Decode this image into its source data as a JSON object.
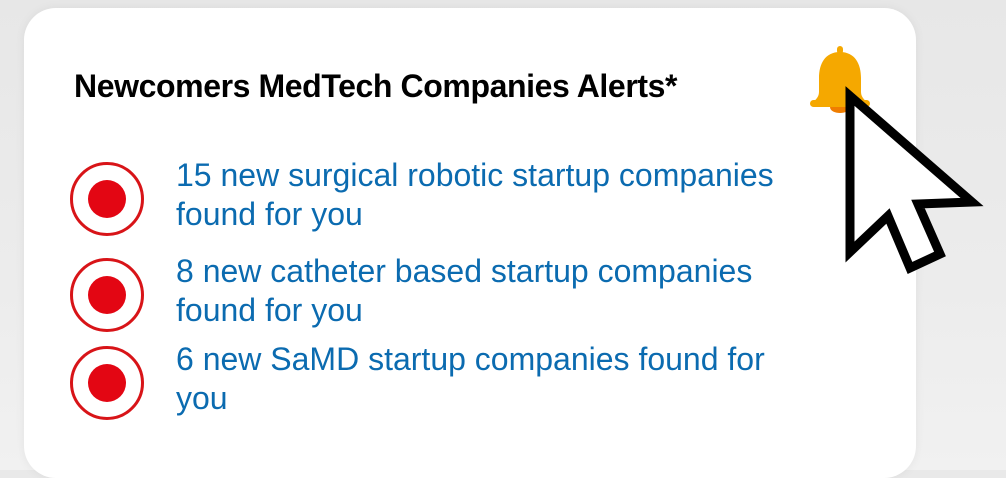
{
  "card": {
    "title": "Newcomers MedTech Companies Alerts*"
  },
  "alerts": [
    {
      "text": "15 new surgical robotic startup companies found for you"
    },
    {
      "text": "8 new catheter based startup companies found for you"
    },
    {
      "text": "6 new SaMD startup companies found for you"
    }
  ],
  "icons": {
    "bell": "bell-icon",
    "bullet": "record-icon",
    "cursor": "mouse-pointer-icon"
  },
  "colors": {
    "title": "#000000",
    "link": "#0b6bb0",
    "bullet": "#e30613",
    "bell_body": "#f5a800",
    "bell_clapper": "#ef7d00",
    "background": "#e9e9e9",
    "card": "#ffffff"
  }
}
